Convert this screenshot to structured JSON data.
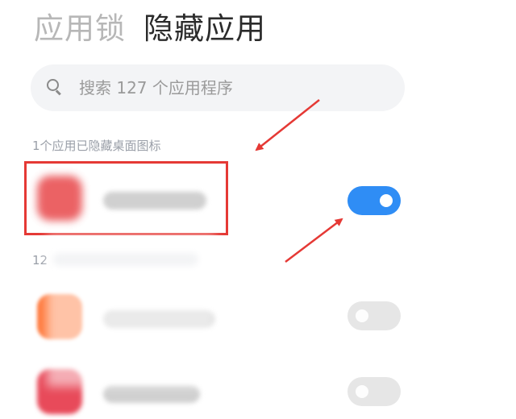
{
  "tabs": [
    {
      "label": "应用锁",
      "active": false
    },
    {
      "label": "隐藏应用",
      "active": true
    }
  ],
  "search": {
    "placeholder": "搜索 127 个应用程序"
  },
  "sections": [
    {
      "label": "1个应用已隐藏桌面图标"
    },
    {
      "label": "12"
    }
  ],
  "apps": [
    {
      "hidden": true,
      "icon_color": "#e8474a"
    },
    {
      "hidden": false,
      "icon_color": "#ff7a3d"
    },
    {
      "hidden": false,
      "icon_color": "#e84a5a"
    }
  ],
  "colors": {
    "accent": "#2f8df5",
    "annotation": "#e53935"
  }
}
